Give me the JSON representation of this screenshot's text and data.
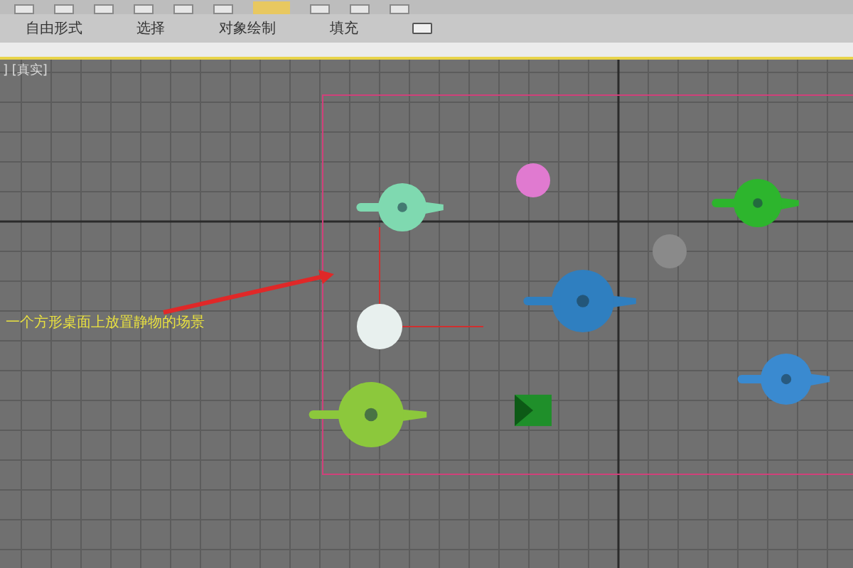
{
  "ribbon": {
    "tabs": [
      {
        "label": "自由形式"
      },
      {
        "label": "选择"
      },
      {
        "label": "对象绘制"
      },
      {
        "label": "填充"
      }
    ]
  },
  "viewport": {
    "label": "] [真实]",
    "annotation": "一个方形桌面上放置静物的场景",
    "objects": [
      {
        "kind": "teapot",
        "color": "#7fd9b0"
      },
      {
        "kind": "sphere",
        "color": "#e07ad0"
      },
      {
        "kind": "teapot",
        "color": "#2db52d"
      },
      {
        "kind": "sphere",
        "color": "#8a8a8a"
      },
      {
        "kind": "teapot",
        "color": "#2f7fc0"
      },
      {
        "kind": "sphere",
        "color": "#e8f0ee"
      },
      {
        "kind": "teapot",
        "color": "#8cc83c"
      },
      {
        "kind": "pyramid",
        "color": "#1f8f2a"
      },
      {
        "kind": "teapot",
        "color": "#3a8ad0"
      }
    ]
  }
}
